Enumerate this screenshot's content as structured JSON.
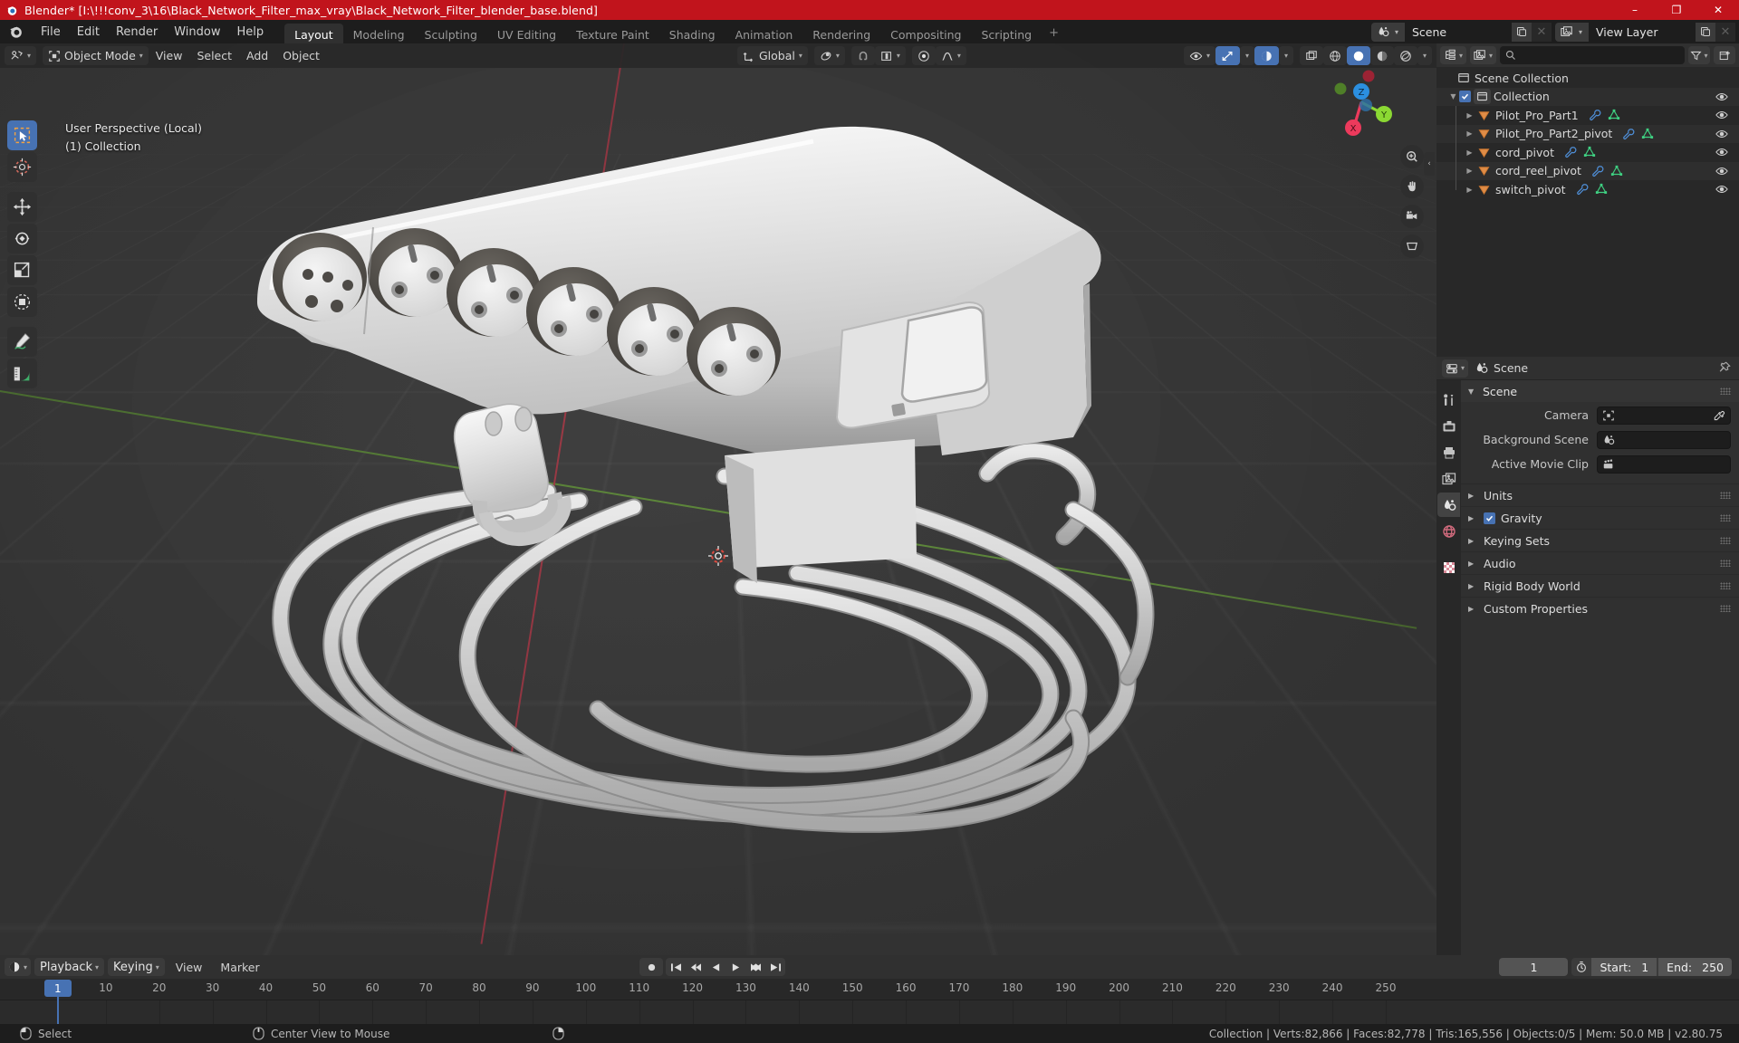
{
  "window": {
    "title": "Blender* [I:\\!!!conv_3\\16\\Black_Network_Filter_max_vray\\Black_Network_Filter_blender_base.blend]",
    "minimize": "–",
    "maximize": "❐",
    "close": "✕",
    "titlebar_color": "#c1141c"
  },
  "topbar": {
    "menus": [
      "File",
      "Edit",
      "Render",
      "Window",
      "Help"
    ],
    "workspaces": [
      {
        "label": "Layout",
        "active": true
      },
      {
        "label": "Modeling",
        "active": false
      },
      {
        "label": "Sculpting",
        "active": false
      },
      {
        "label": "UV Editing",
        "active": false
      },
      {
        "label": "Texture Paint",
        "active": false
      },
      {
        "label": "Shading",
        "active": false
      },
      {
        "label": "Animation",
        "active": false
      },
      {
        "label": "Rendering",
        "active": false
      },
      {
        "label": "Compositing",
        "active": false
      },
      {
        "label": "Scripting",
        "active": false
      }
    ],
    "add_workspace": "+",
    "scene_name": "Scene",
    "view_layer_name": "View Layer"
  },
  "viewport": {
    "mode": "Object Mode",
    "menus": [
      "View",
      "Select",
      "Add",
      "Object"
    ],
    "transform_orientation": "Global",
    "overlay_line1": "User Perspective (Local)",
    "overlay_line2": "(1) Collection",
    "gizmo_axes": {
      "x": "X",
      "y": "Y",
      "z": "Z"
    },
    "shading_modes": [
      "wireframe",
      "solid",
      "material-preview",
      "rendered"
    ],
    "active_shading": "solid",
    "tools": [
      {
        "name": "tweak-select-box",
        "active": true
      },
      {
        "name": "cursor",
        "active": false
      },
      {
        "name": "move",
        "active": false
      },
      {
        "name": "rotate",
        "active": false
      },
      {
        "name": "scale",
        "active": false
      },
      {
        "name": "transform",
        "active": false
      },
      {
        "name": "annotate",
        "active": false
      },
      {
        "name": "measure",
        "active": false
      }
    ]
  },
  "outliner": {
    "display_mode": "View Layer",
    "search_placeholder": "",
    "rows": [
      {
        "label": "Scene Collection",
        "icon": "collection-icon",
        "depth": 0,
        "has_disclosure": false,
        "has_checkbox": false,
        "has_eye": false,
        "modifiers": []
      },
      {
        "label": "Collection",
        "icon": "collection-icon",
        "depth": 1,
        "has_disclosure": true,
        "has_checkbox": true,
        "has_eye": true,
        "modifiers": []
      },
      {
        "label": "Pilot_Pro_Part1",
        "icon": "object-icon",
        "depth": 2,
        "has_disclosure": true,
        "has_checkbox": false,
        "has_eye": true,
        "modifiers": [
          "wrench-icon",
          "mesh-data-icon"
        ]
      },
      {
        "label": "Pilot_Pro_Part2_pivot",
        "icon": "object-icon",
        "depth": 2,
        "has_disclosure": true,
        "has_checkbox": false,
        "has_eye": true,
        "modifiers": [
          "wrench-icon",
          "mesh-data-icon"
        ]
      },
      {
        "label": "cord_pivot",
        "icon": "object-icon",
        "depth": 2,
        "has_disclosure": true,
        "has_checkbox": false,
        "has_eye": true,
        "modifiers": [
          "wrench-icon",
          "mesh-data-icon"
        ]
      },
      {
        "label": "cord_reel_pivot",
        "icon": "object-icon",
        "depth": 2,
        "has_disclosure": true,
        "has_checkbox": false,
        "has_eye": true,
        "modifiers": [
          "wrench-icon",
          "mesh-data-icon"
        ]
      },
      {
        "label": "switch_pivot",
        "icon": "object-icon",
        "depth": 2,
        "has_disclosure": true,
        "has_checkbox": false,
        "has_eye": true,
        "modifiers": [
          "wrench-icon",
          "mesh-data-icon"
        ]
      }
    ]
  },
  "properties": {
    "breadcrumb": "Scene",
    "tabs": [
      {
        "name": "tool",
        "active": false
      },
      {
        "name": "render",
        "active": false
      },
      {
        "name": "output",
        "active": false
      },
      {
        "name": "view-layer",
        "active": false
      },
      {
        "name": "scene",
        "active": true
      },
      {
        "name": "world",
        "active": false
      },
      {
        "name": "texture",
        "active": false
      }
    ],
    "panel_title": "Scene",
    "fields": [
      {
        "label": "Camera",
        "value": "",
        "icon": "camera-icon",
        "has_eyedropper": true
      },
      {
        "label": "Background Scene",
        "value": "",
        "icon": "scene-icon",
        "has_eyedropper": false
      },
      {
        "label": "Active Movie Clip",
        "value": "",
        "icon": "clip-icon",
        "has_eyedropper": false
      }
    ],
    "subpanels": [
      {
        "label": "Units",
        "checkbox": null
      },
      {
        "label": "Gravity",
        "checkbox": true
      },
      {
        "label": "Keying Sets",
        "checkbox": null
      },
      {
        "label": "Audio",
        "checkbox": null
      },
      {
        "label": "Rigid Body World",
        "checkbox": null
      },
      {
        "label": "Custom Properties",
        "checkbox": null
      }
    ]
  },
  "timeline": {
    "menus": [
      "Playback",
      "Keying",
      "View",
      "Marker"
    ],
    "current_frame": "1",
    "start_label": "Start:",
    "start_value": "1",
    "end_label": "End:",
    "end_value": "250",
    "ticks": [
      10,
      20,
      30,
      40,
      50,
      60,
      70,
      80,
      90,
      100,
      110,
      120,
      130,
      140,
      150,
      160,
      170,
      180,
      190,
      200,
      210,
      220,
      230,
      240,
      250
    ],
    "playhead_frame": "1"
  },
  "statusbar": {
    "mouse_left_action": "Select",
    "mouse_middle_action": "Center View to Mouse",
    "stats": "Collection | Verts:82,866 | Faces:82,778 | Tris:165,556 | Objects:0/5 | Mem: 50.0 MB | v2.80.75"
  },
  "colors": {
    "accent_blue": "#4772b3",
    "title_red": "#c1141c",
    "viewport_bg": "#393939",
    "panel_bg": "#303030",
    "outliner_bg": "#282828",
    "object_orange": "#ed9e5c",
    "mesh_green": "#44d17a"
  }
}
